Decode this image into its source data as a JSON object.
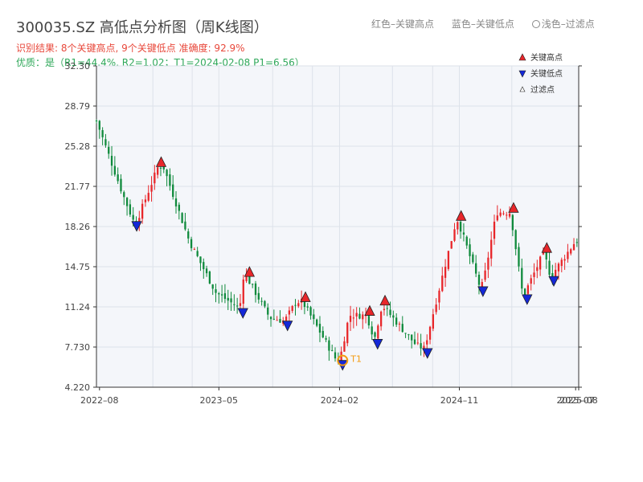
{
  "header": {
    "title": "300035.SZ 高低点分析图（周K线图）",
    "legend_red": "红色–关键高点",
    "legend_blue": "蓝色–关键低点",
    "legend_light": "浅色–过滤点",
    "result_line": "识别结果: 8个关键高点, 9个关键低点 准确度: 92.9%",
    "quality_line": "优质：是（R1=44.4%, R2=1.02；T1=2024-02-08 P1=6.56）"
  },
  "colors": {
    "up": "#e8262a",
    "down": "#0f8a3c",
    "high_marker": "#e8262a",
    "low_marker": "#1428d8",
    "t1_marker": "#f39c12",
    "plot_bg": "#f4f6fa",
    "grid": "#dde2ea"
  },
  "chart_data": {
    "type": "candlestick",
    "yticks": [
      "4.220",
      "7.730",
      "11.24",
      "14.75",
      "18.26",
      "21.77",
      "25.28",
      "28.79",
      "32.30"
    ],
    "ylim": [
      4.22,
      32.3
    ],
    "xticks": [
      "2022–08",
      "2023–05",
      "2024–02",
      "2024–11",
      "2025–07",
      "2025–08"
    ],
    "grid": true,
    "legend": {
      "position": "top-right",
      "items": [
        {
          "label": "关键高点",
          "marker": "high"
        },
        {
          "label": "关键低点",
          "marker": "low"
        },
        {
          "label": "过滤点",
          "marker": "filtered"
        }
      ]
    },
    "t1_label": "T1",
    "series": [
      {
        "date": "2022-08",
        "close": 27.5
      },
      {
        "date": "2022-10",
        "close": 21.0
      },
      {
        "date": "2022-11",
        "close": 18.7
      },
      {
        "date": "2023-01",
        "close": 23.5
      },
      {
        "date": "2023-03",
        "close": 17.0
      },
      {
        "date": "2023-05",
        "close": 12.5
      },
      {
        "date": "2023-07",
        "close": 13.9
      },
      {
        "date": "2023-09",
        "close": 10.3
      },
      {
        "date": "2023-11",
        "close": 11.7
      },
      {
        "date": "2024-02",
        "close": 6.56
      },
      {
        "date": "2024-03",
        "close": 10.5
      },
      {
        "date": "2024-05",
        "close": 9.0
      },
      {
        "date": "2024-08",
        "close": 7.9
      },
      {
        "date": "2024-11",
        "close": 18.8
      },
      {
        "date": "2025-01",
        "close": 13.2
      },
      {
        "date": "2025-02",
        "close": 19.5
      },
      {
        "date": "2025-04",
        "close": 12.5
      },
      {
        "date": "2025-08",
        "close": 17.0
      }
    ],
    "key_highs": [
      {
        "date": "2022-12-20",
        "price": 23.5
      },
      {
        "date": "2023-07-10",
        "price": 13.9
      },
      {
        "date": "2023-11-15",
        "price": 11.7
      },
      {
        "date": "2024-04-10",
        "price": 10.5
      },
      {
        "date": "2024-05-15",
        "price": 11.4
      },
      {
        "date": "2024-11-05",
        "price": 18.8
      },
      {
        "date": "2025-03-05",
        "price": 19.5
      },
      {
        "date": "2025-05-20",
        "price": 16.0
      }
    ],
    "key_lows": [
      {
        "date": "2022-10-25",
        "price": 18.7
      },
      {
        "date": "2023-06-25",
        "price": 11.1
      },
      {
        "date": "2023-10-05",
        "price": 10.0
      },
      {
        "date": "2024-02-08",
        "price": 6.56
      },
      {
        "date": "2024-04-28",
        "price": 8.4
      },
      {
        "date": "2024-08-20",
        "price": 7.6
      },
      {
        "date": "2024-12-25",
        "price": 13.0
      },
      {
        "date": "2025-04-05",
        "price": 12.3
      },
      {
        "date": "2025-06-05",
        "price": 13.9
      }
    ],
    "t1": {
      "date": "2024-02-08",
      "price": 6.56
    }
  }
}
